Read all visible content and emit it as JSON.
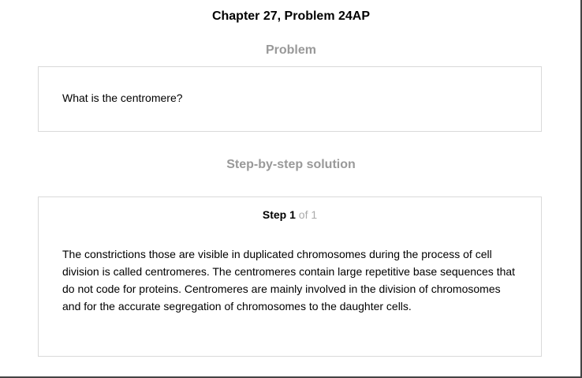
{
  "chapter_title": "Chapter 27, Problem 24AP",
  "problem": {
    "heading": "Problem",
    "question": "What is the centromere?"
  },
  "solution": {
    "heading": "Step-by-step solution",
    "step_word": "Step",
    "step_number": "1",
    "step_total": "of 1",
    "text": "The constrictions those are visible in duplicated chromosomes during the process of cell division is called centromeres. The centromeres contain large repetitive base sequences that do not code for proteins. Centromeres are mainly involved in the division of chromosomes and for the accurate segregation of chromosomes to the daughter cells."
  }
}
